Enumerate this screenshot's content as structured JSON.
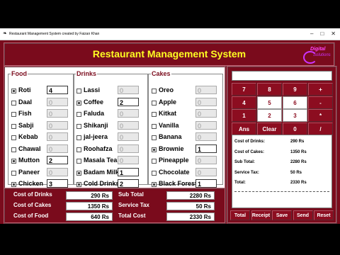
{
  "window": {
    "title": "Restaurant Management System created by Faizan Khan"
  },
  "header": {
    "title": "Restaurant Management  System",
    "logo_line1": "Digital",
    "logo_line2": "Solutions"
  },
  "food": {
    "legend": "Food",
    "items": [
      {
        "label": "Roti",
        "qty": "4",
        "checked": true
      },
      {
        "label": "Daal",
        "qty": "0",
        "checked": false
      },
      {
        "label": "Fish",
        "qty": "0",
        "checked": false
      },
      {
        "label": "Sabji",
        "qty": "0",
        "checked": false
      },
      {
        "label": "Kebab",
        "qty": "0",
        "checked": false
      },
      {
        "label": "Chawal",
        "qty": "0",
        "checked": false
      },
      {
        "label": "Mutton",
        "qty": "2",
        "checked": true
      },
      {
        "label": "Paneer",
        "qty": "0",
        "checked": false
      },
      {
        "label": "Chicken",
        "qty": "3",
        "checked": true
      }
    ]
  },
  "drinks": {
    "legend": "Drinks",
    "items": [
      {
        "label": "Lassi",
        "qty": "0",
        "checked": false
      },
      {
        "label": "Coffee",
        "qty": "2",
        "checked": true
      },
      {
        "label": "Faluda",
        "qty": "0",
        "checked": false
      },
      {
        "label": "Shikanji",
        "qty": "0",
        "checked": false
      },
      {
        "label": "jal-jeera",
        "qty": "0",
        "checked": false
      },
      {
        "label": "Roohafza",
        "qty": "0",
        "checked": false
      },
      {
        "label": "Masala Tea",
        "qty": "0",
        "checked": false
      },
      {
        "label": "Badam Milk",
        "qty": "1",
        "checked": true
      },
      {
        "label": "Cold Drinks",
        "qty": "2",
        "checked": true
      }
    ]
  },
  "cakes": {
    "legend": "Cakes",
    "items": [
      {
        "label": "Oreo",
        "qty": "0",
        "checked": false
      },
      {
        "label": "Apple",
        "qty": "0",
        "checked": false
      },
      {
        "label": "Kitkat",
        "qty": "0",
        "checked": false
      },
      {
        "label": "Vanilla",
        "qty": "0",
        "checked": false
      },
      {
        "label": "Banana",
        "qty": "0",
        "checked": false
      },
      {
        "label": "Brownie",
        "qty": "1",
        "checked": true
      },
      {
        "label": "Pineapple",
        "qty": "0",
        "checked": false
      },
      {
        "label": "Chocolate",
        "qty": "0",
        "checked": false
      },
      {
        "label": "Black Forest",
        "qty": "1",
        "checked": true
      }
    ]
  },
  "totals": {
    "cost_drinks_label": "Cost of Drinks",
    "cost_drinks": "290 Rs",
    "cost_cakes_label": "Cost of Cakes",
    "cost_cakes": "1350 Rs",
    "cost_food_label": "Cost of Food",
    "cost_food": "640 Rs",
    "subtotal_label": "Sub Total",
    "subtotal": "2280 Rs",
    "service_tax_label": "Service Tax",
    "service_tax": "50 Rs",
    "total_cost_label": "Total Cost",
    "total_cost": "2330 Rs"
  },
  "calculator": {
    "display": "",
    "keys": [
      "7",
      "8",
      "9",
      "+",
      "4",
      "5",
      "6",
      "-",
      "1",
      "2",
      "3",
      "*",
      "Ans",
      "Clear",
      "0",
      "/"
    ]
  },
  "receipt": {
    "lines": [
      {
        "label": "Cost of Drinks:",
        "value": "290 Rs"
      },
      {
        "label": "Cost of Cakes:",
        "value": "1350 Rs"
      },
      {
        "label": "Sub Total:",
        "value": "2280 Rs"
      },
      {
        "label": "Service Tax:",
        "value": "50 Rs"
      },
      {
        "label": "Total:",
        "value": "2330 Rs"
      }
    ]
  },
  "actions": [
    "Total",
    "Receipt",
    "Save",
    "Send",
    "Reset"
  ],
  "colors": {
    "panel": "#7a0b1c",
    "title": "#ffff22"
  }
}
